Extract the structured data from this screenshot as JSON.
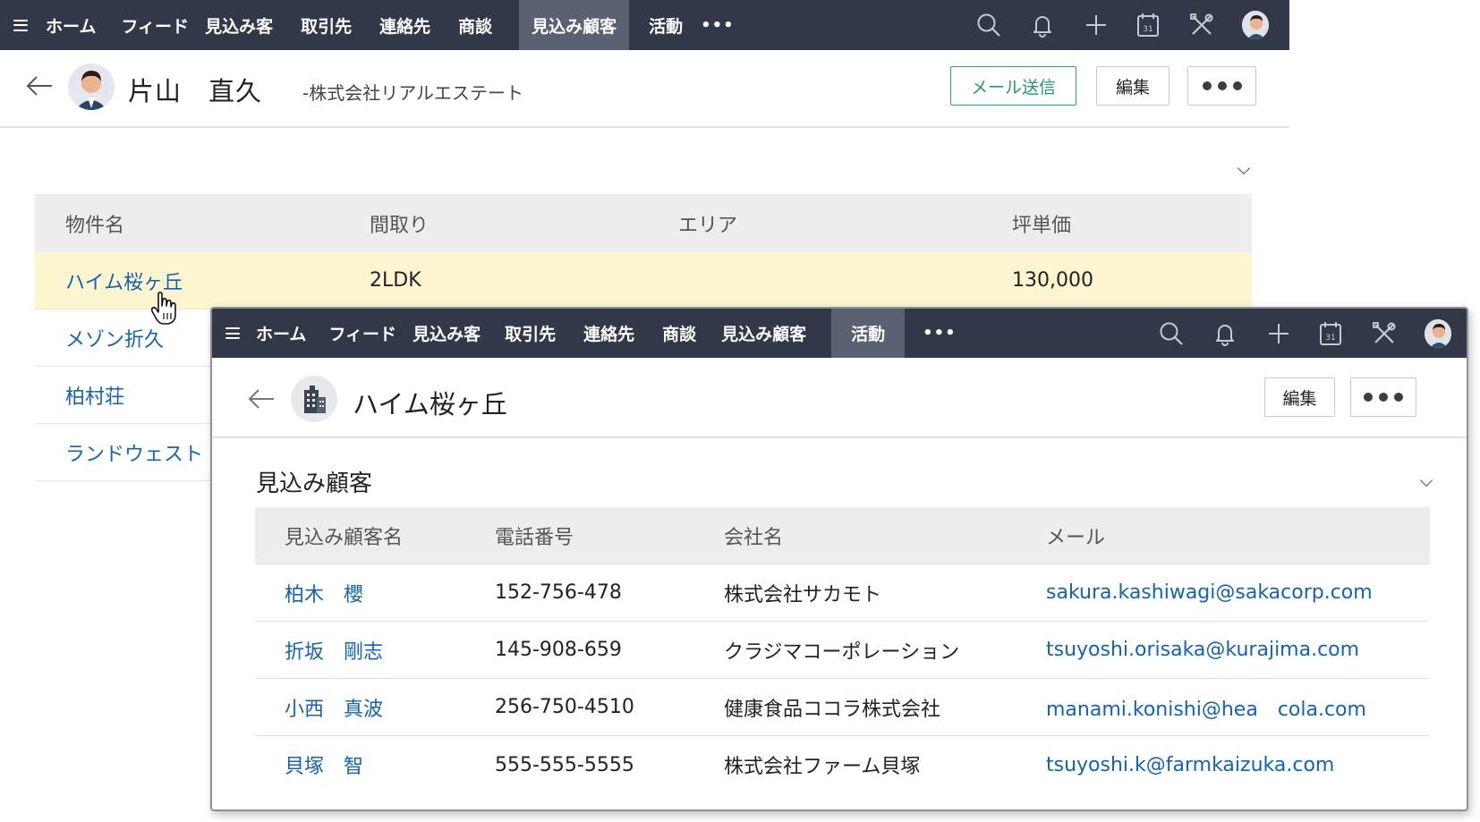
{
  "nav": {
    "items": [
      "ホーム",
      "フィード",
      "見込み客",
      "取引先",
      "連絡先",
      "商談",
      "見込み顧客",
      "活動"
    ],
    "more": "•••",
    "base_active": "見込み顧客",
    "popup_active": "活動",
    "icons": [
      "search-icon",
      "bell-icon",
      "plus-icon",
      "calendar-icon",
      "tools-icon",
      "avatar"
    ],
    "calendar_day": "31"
  },
  "contact": {
    "name": "片山　直久",
    "company": "-株式会社リアルエステート",
    "buttons": {
      "mail": "メール送信",
      "edit": "編集"
    }
  },
  "properties": {
    "headers": [
      "物件名",
      "間取り",
      "エリア",
      "坪単価"
    ],
    "rows": [
      {
        "name": "ハイム桜ヶ丘",
        "layout": "2LDK",
        "area": "",
        "price": "130,000"
      },
      {
        "name": "メゾン折久"
      },
      {
        "name": "柏村荘"
      },
      {
        "name": "ランドウェスト"
      }
    ]
  },
  "property_detail": {
    "title": "ハイム桜ヶ丘",
    "edit_button": "編集",
    "section_title": "見込み顧客",
    "headers": [
      "見込み顧客名",
      "電話番号",
      "会社名",
      "メール"
    ],
    "rows": [
      {
        "name": "柏木　櫻",
        "phone": "152-756-478",
        "company": "株式会社サカモト",
        "email": "sakura.kashiwagi@sakacorp.com"
      },
      {
        "name": "折坂　剛志",
        "phone": "145-908-659",
        "company": "クラジマコーポレーション",
        "email": "tsuyoshi.orisaka@kurajima.com"
      },
      {
        "name": "小西　真波",
        "phone": "256-750-4510",
        "company": "健康食品ココラ株式会社",
        "email": "manami.konishi@hea　cola.com"
      },
      {
        "name": "貝塚　智",
        "phone": "555-555-5555",
        "company": "株式会社ファーム貝塚",
        "email": "tsuyoshi.k@farmkaizuka.com"
      }
    ]
  },
  "colors": {
    "nav_bg": "#313949",
    "nav_active": "#5a6271",
    "link": "#1563b0",
    "highlight_row": "#fdf5cf",
    "mail_button": "#2aa27a"
  }
}
